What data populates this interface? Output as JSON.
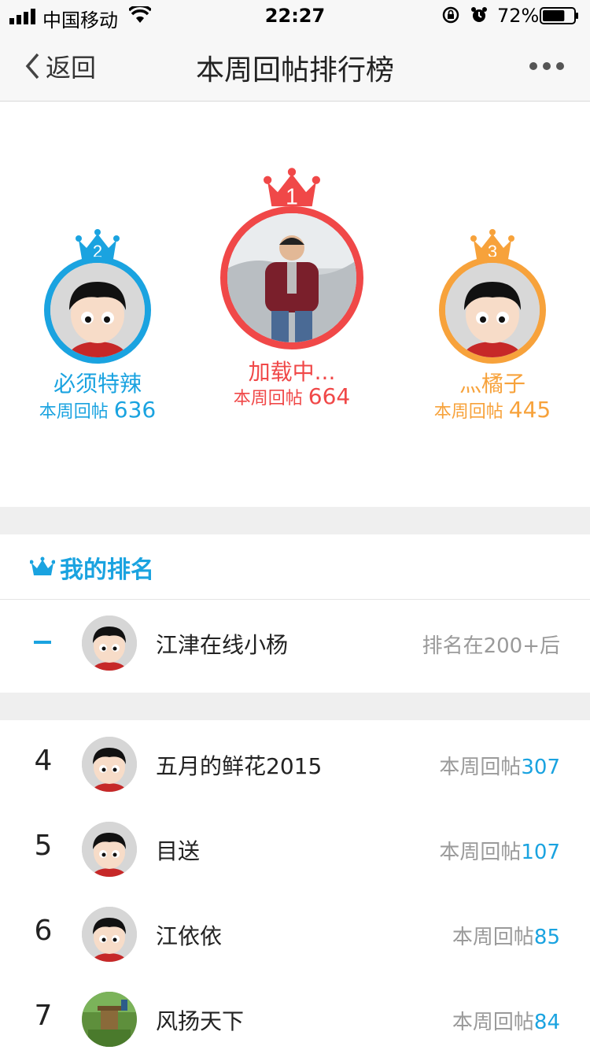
{
  "status_bar": {
    "carrier": "中国移动",
    "time": "22:27",
    "battery": "72%",
    "battery_level": 0.72
  },
  "nav": {
    "back_label": "返回",
    "title": "本周回帖排行榜"
  },
  "podium": [
    {
      "rank": "2",
      "name": "必须特辣",
      "count_label": "本周回帖",
      "count": "636",
      "color": "#1aa3e0"
    },
    {
      "rank": "1",
      "name": "加载中...",
      "count_label": "本周回帖",
      "count": "664",
      "color": "#f04848"
    },
    {
      "rank": "3",
      "name": "灬橘子",
      "count_label": "本周回帖",
      "count": "445",
      "color": "#f7a23b"
    }
  ],
  "my_rank": {
    "header": "我的排名",
    "name": "江津在线小杨",
    "rank_text": "排名在200+后"
  },
  "list": [
    {
      "rank": "4",
      "name": "五月的鲜花2015",
      "count_label": "本周回帖",
      "count": "307"
    },
    {
      "rank": "5",
      "name": "目送",
      "count_label": "本周回帖",
      "count": "107"
    },
    {
      "rank": "6",
      "name": "江依依",
      "count_label": "本周回帖",
      "count": "85"
    },
    {
      "rank": "7",
      "name": "风扬天下",
      "count_label": "本周回帖",
      "count": "84"
    }
  ],
  "colors": {
    "accent": "#1aa3e0",
    "first": "#f04848",
    "third": "#f7a23b"
  }
}
